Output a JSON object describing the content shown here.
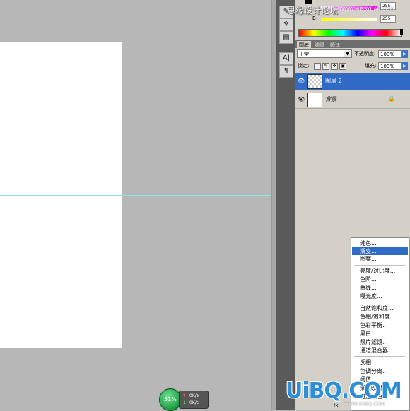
{
  "watermark": {
    "site_cn": "思缘设计论坛",
    "url": "WWW.MISSYUAN.COM",
    "brand": "UiBQ.COM",
    "brand_url": "WWW.UIBQ.COM"
  },
  "color_panel": {
    "channels": [
      {
        "name": "",
        "value": "255"
      },
      {
        "name": "B",
        "value": "255"
      }
    ]
  },
  "layers_panel": {
    "tabs": [
      "图层",
      "通道",
      "路径"
    ],
    "blend_mode": "正常",
    "opacity_label": "不透明度:",
    "opacity_value": "100%",
    "lock_label": "锁定:",
    "fill_label": "填充:",
    "fill_value": "100%",
    "layers": [
      {
        "name": "图层 2",
        "selected": true,
        "transparent": true
      },
      {
        "name": "背景",
        "selected": false,
        "transparent": false,
        "locked": true
      }
    ]
  },
  "context_menu": {
    "items": [
      {
        "label": "纯色...",
        "selected": false
      },
      {
        "label": "渐变...",
        "selected": true
      },
      {
        "label": "图案...",
        "selected": false
      },
      {
        "label": "亮度/对比度...",
        "selected": false
      },
      {
        "label": "色阶...",
        "selected": false
      },
      {
        "label": "曲线...",
        "selected": false
      },
      {
        "label": "曝光度...",
        "selected": false
      },
      {
        "label": "自然饱和度...",
        "selected": false
      },
      {
        "label": "色相/饱和度...",
        "selected": false
      },
      {
        "label": "色彩平衡...",
        "selected": false
      },
      {
        "label": "黑白...",
        "selected": false
      },
      {
        "label": "照片滤镜...",
        "selected": false
      },
      {
        "label": "通道混合器...",
        "selected": false
      },
      {
        "label": "反相",
        "selected": false
      },
      {
        "label": "色调分离...",
        "selected": false
      },
      {
        "label": "阈值...",
        "selected": false
      },
      {
        "label": "渐变映射...",
        "selected": false
      },
      {
        "label": "可选颜色...",
        "selected": false
      }
    ]
  },
  "network_meter": {
    "percent": "51%",
    "up": "0K/s",
    "down": "0K/s"
  },
  "bottom_bar": {
    "fx": "fx."
  },
  "colors": {
    "selection": "#316ac5",
    "guide": "#8fe3f2",
    "brand": "#2e8fd6"
  }
}
